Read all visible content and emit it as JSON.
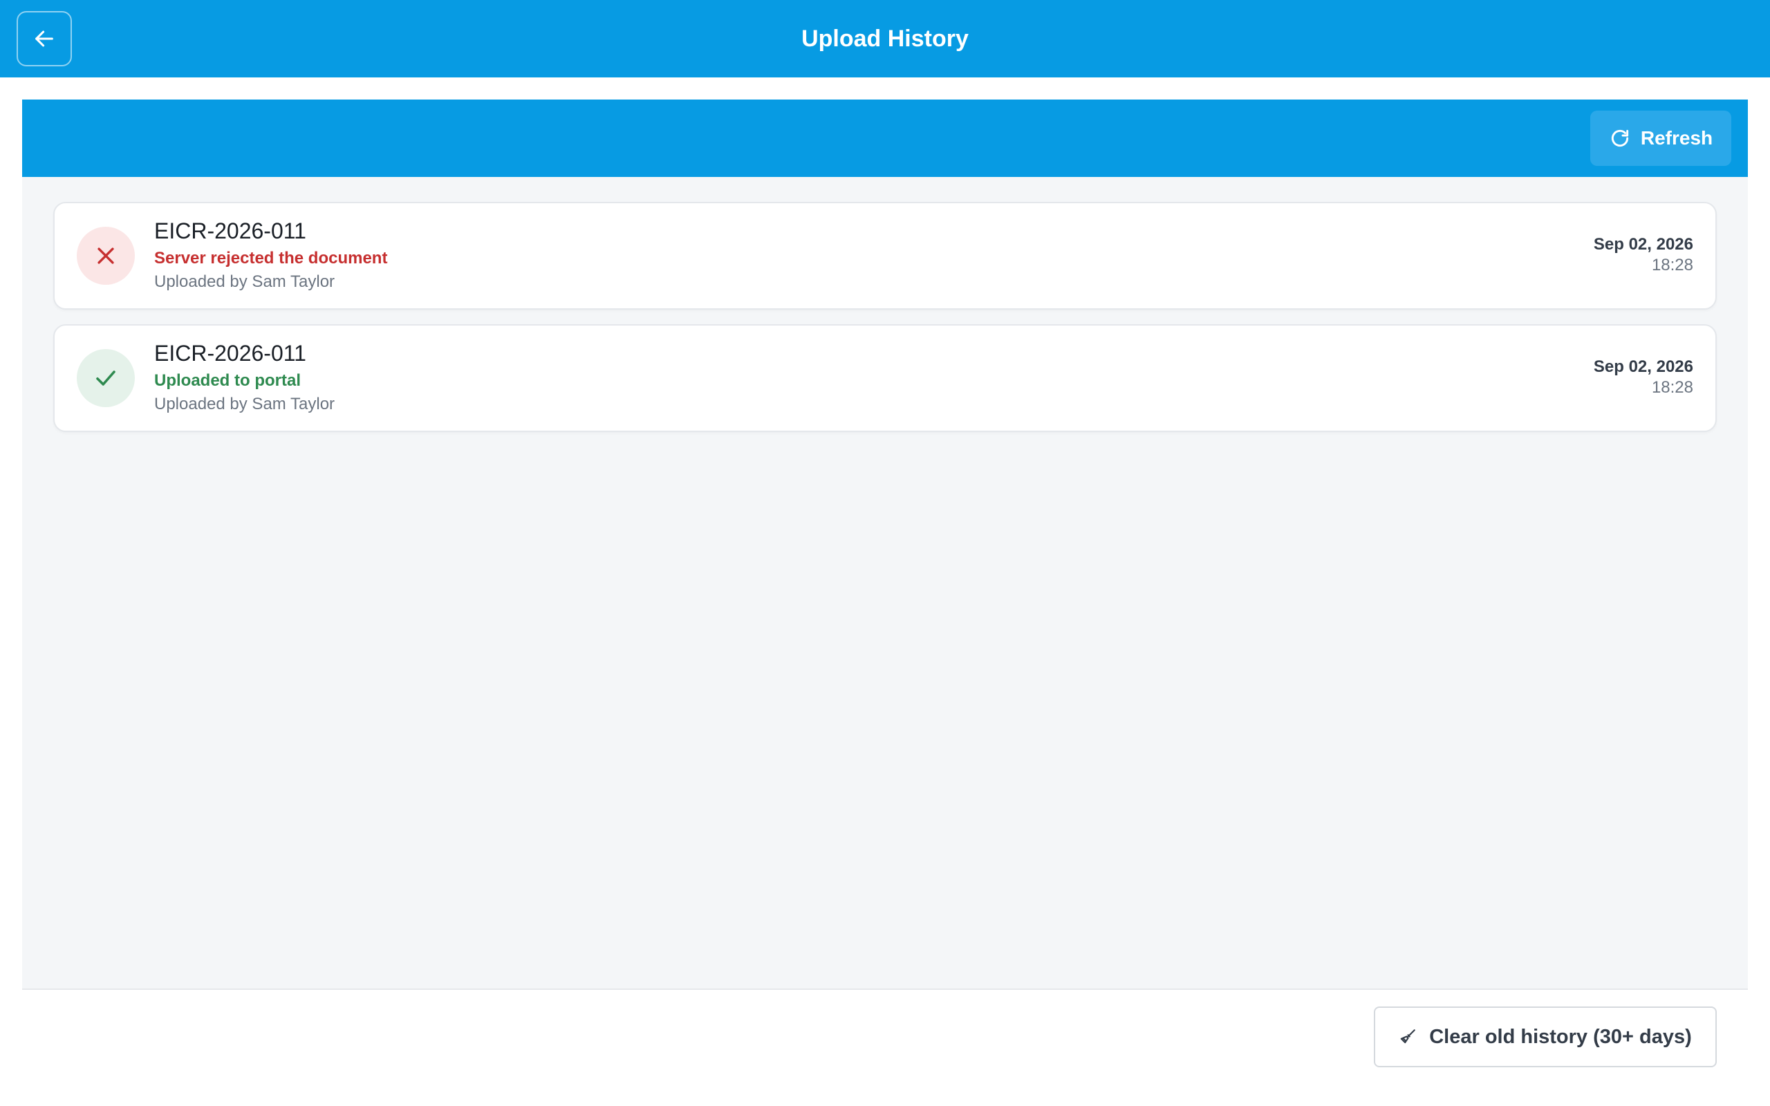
{
  "header": {
    "title": "Upload History",
    "back_icon": "arrow-left-icon"
  },
  "toolbar": {
    "refresh_label": "Refresh",
    "refresh_icon": "refresh-icon"
  },
  "uploads": [
    {
      "title": "EICR-2026-011",
      "status": "Server rejected the document",
      "status_type": "error",
      "status_icon": "x-icon",
      "uploaded_by": "Uploaded by Sam Taylor",
      "date": "Sep 02, 2026",
      "time": "18:28"
    },
    {
      "title": "EICR-2026-011",
      "status": "Uploaded to portal",
      "status_type": "success",
      "status_icon": "check-icon",
      "uploaded_by": "Uploaded by Sam Taylor",
      "date": "Sep 02, 2026",
      "time": "18:28"
    }
  ],
  "footer": {
    "clear_label": "Clear old history (30+ days)",
    "clear_icon": "broom-icon"
  },
  "colors": {
    "primary": "#079be3",
    "error": "#c62f2f",
    "success": "#2e8a4f",
    "background": "#f4f6f8"
  }
}
